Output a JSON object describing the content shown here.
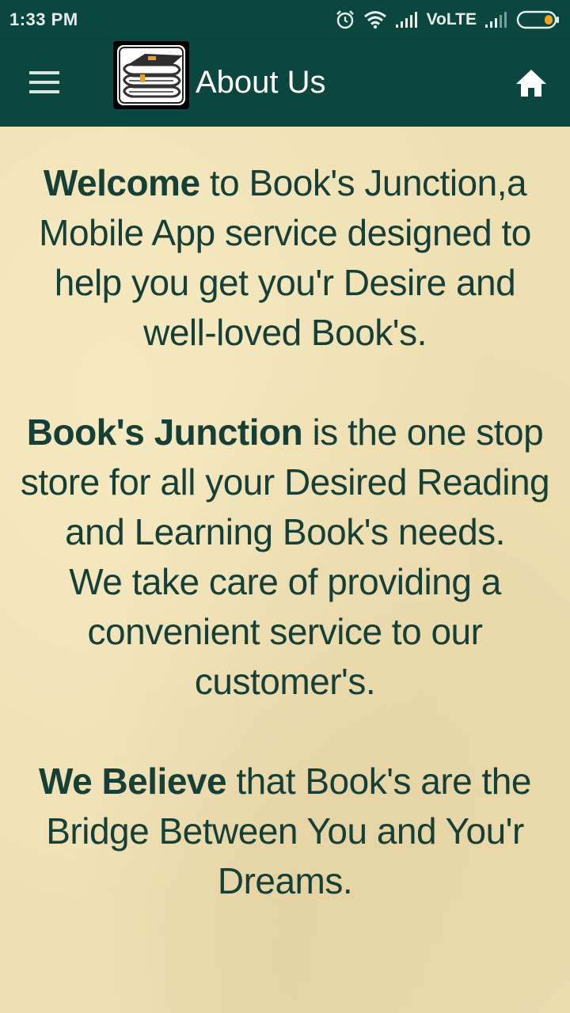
{
  "status_bar": {
    "time": "1:33 PM",
    "network_label": "VoLTE",
    "icons": [
      "alarm-icon",
      "wifi-icon",
      "signal-icon",
      "signal-icon",
      "battery-icon"
    ]
  },
  "app_bar": {
    "title": "About Us",
    "menu_icon": "hamburger-menu-icon",
    "logo_icon": "books-stack-icon",
    "home_icon": "home-icon"
  },
  "content": {
    "p1_bold": "Welcome",
    "p1_rest": " to Book's Junction,a Mobile App service designed to help you get you'r Desire and well-loved Book's.",
    "p2_bold": "Book's Junction",
    "p2_rest": " is the one stop store for all your Desired Reading and Learning Book's needs.",
    "p3": " We take care of providing a convenient service to our customer's.",
    "p4_bold": "We Believe",
    "p4_rest": " that Book's are the Bridge Between You and You'r Dreams."
  },
  "colors": {
    "bar_bg": "#0c4640",
    "text": "#153f37",
    "paper": "#efe0b4",
    "battery_accent": "#f0a11f"
  }
}
